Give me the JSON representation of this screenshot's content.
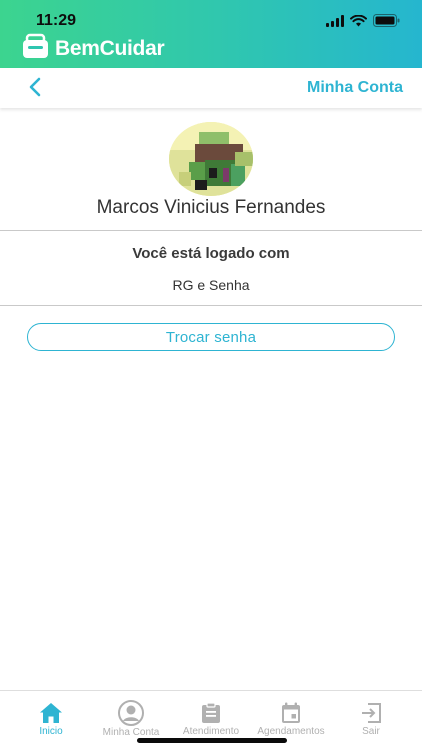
{
  "status_bar": {
    "time": "11:29"
  },
  "brand": {
    "name": "BemCuidar",
    "color": "#ffffff",
    "gradient": [
      "#3cd48f",
      "#25b6cf"
    ]
  },
  "nav": {
    "title": "Minha Conta",
    "back_icon": "chevron-left-icon",
    "accent": "#2eb4d2"
  },
  "profile": {
    "name": "Marcos Vinicius Fernandes",
    "avatar_icon": "user-photo"
  },
  "login": {
    "title": "Você está logado com",
    "method": "RG e Senha"
  },
  "actions": {
    "change_password_label": "Trocar senha"
  },
  "tab_bar": {
    "active_color": "#2eb4d2",
    "inactive_color": "#b0b0b0",
    "items": [
      {
        "label": "Inicio",
        "icon": "home-icon",
        "active": true
      },
      {
        "label": "Minha Conta",
        "icon": "user-circle-icon",
        "active": false
      },
      {
        "label": "Atendimento",
        "icon": "clipboard-icon",
        "active": false
      },
      {
        "label": "Agendamentos",
        "icon": "calendar-icon",
        "active": false
      },
      {
        "label": "Sair",
        "icon": "logout-icon",
        "active": false
      }
    ]
  }
}
